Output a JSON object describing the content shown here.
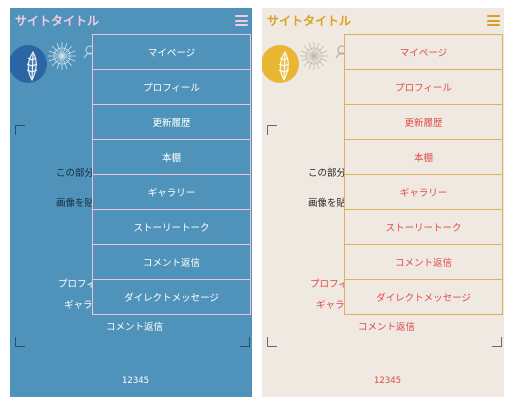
{
  "themes": [
    {
      "id": "blue",
      "site_title": "サイトタイトル",
      "body_texts": [
        "この部分",
        "画像を貼",
        "プロフィ",
        "ギャラ",
        "コメント返信"
      ],
      "pager": "12345",
      "menu_items": [
        "マイページ",
        "プロフィール",
        "更新履歴",
        "本棚",
        "ギャラリー",
        "ストーリートーク",
        "コメント返信",
        "ダイレクトメッセージ"
      ],
      "colors": {
        "background": "#4f93ba",
        "title": "#f6c9e3",
        "menu_border": "#f1bfdc",
        "menu_text": "#ffffff"
      }
    },
    {
      "id": "cream",
      "site_title": "サイトタイトル",
      "body_texts": [
        "この部分",
        "画像を貼",
        "プロフィ",
        "ギャラ",
        "コメント返信"
      ],
      "pager": "12345",
      "menu_items": [
        "マイページ",
        "プロフィール",
        "更新履歴",
        "本棚",
        "ギャラリー",
        "ストーリートーク",
        "コメント返信",
        "ダイレクトメッセージ"
      ],
      "colors": {
        "background": "#efe9e1",
        "title": "#d9a021",
        "menu_border": "#dbb25a",
        "menu_text": "#e04c4c"
      }
    }
  ],
  "icons": {
    "menu": "hamburger-menu-icon",
    "decoration": "decorative-leaf-sunburst-image"
  }
}
